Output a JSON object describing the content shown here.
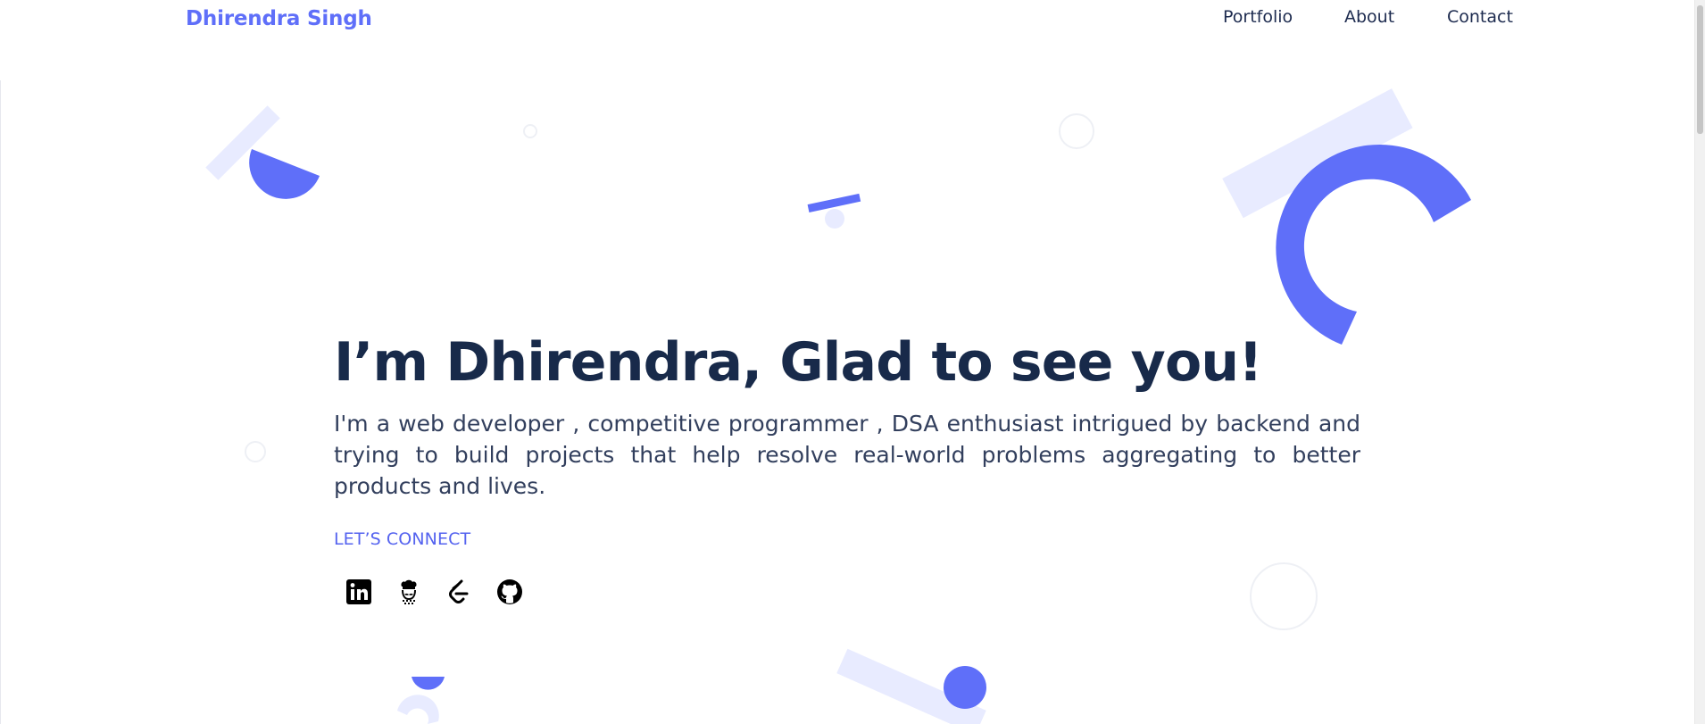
{
  "header": {
    "brand": "Dhirendra Singh",
    "nav": [
      {
        "label": "Portfolio"
      },
      {
        "label": "About"
      },
      {
        "label": "Contact"
      }
    ]
  },
  "hero": {
    "headline": "I’m Dhirendra, Glad to see you!",
    "intro": "I'm a web developer , competitive programmer , DSA enthusiast intrigued by backend and trying to build projects that help resolve real-world problems aggregating to better products and lives.",
    "connect_label": "LET’S CONNECT",
    "social_links": [
      {
        "icon": "linkedin-icon"
      },
      {
        "icon": "codechef-icon"
      },
      {
        "icon": "leetcode-icon"
      },
      {
        "icon": "github-icon"
      }
    ]
  },
  "colors": {
    "brand": "#5f6ff9",
    "shape_primary": "#5f6ff9",
    "shape_light": "#e8ebff",
    "headline": "#182a4a",
    "body_text": "#323f5d",
    "accent_text": "#5563ef"
  }
}
